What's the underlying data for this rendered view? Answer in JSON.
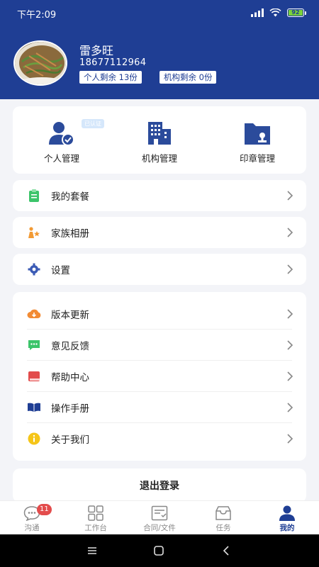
{
  "status": {
    "time": "下午2:09",
    "battery": "92"
  },
  "profile": {
    "name": "雷多旺",
    "phone": "18677112964",
    "personal_remaining": "个人剩余 13份",
    "org_remaining": "机构剩余 0份"
  },
  "management": {
    "verified_badge": "已认证",
    "items": [
      {
        "label": "个人管理",
        "icon": "person-check-icon"
      },
      {
        "label": "机构管理",
        "icon": "building-icon"
      },
      {
        "label": "印章管理",
        "icon": "seal-folder-icon"
      }
    ]
  },
  "menu": {
    "package": "我的套餐",
    "family": "家族相册",
    "settings": "设置",
    "version": "版本更新",
    "feedback": "意见反馈",
    "help": "帮助中心",
    "manual": "操作手册",
    "about": "关于我们"
  },
  "logout": "退出登录",
  "tabs": [
    {
      "label": "沟通",
      "badge": "11"
    },
    {
      "label": "工作台"
    },
    {
      "label": "合同/文件"
    },
    {
      "label": "任务"
    },
    {
      "label": "我的"
    }
  ],
  "colors": {
    "brand": "#1f3e94",
    "badge": "#e34c4c",
    "battery": "#7bd33a"
  }
}
